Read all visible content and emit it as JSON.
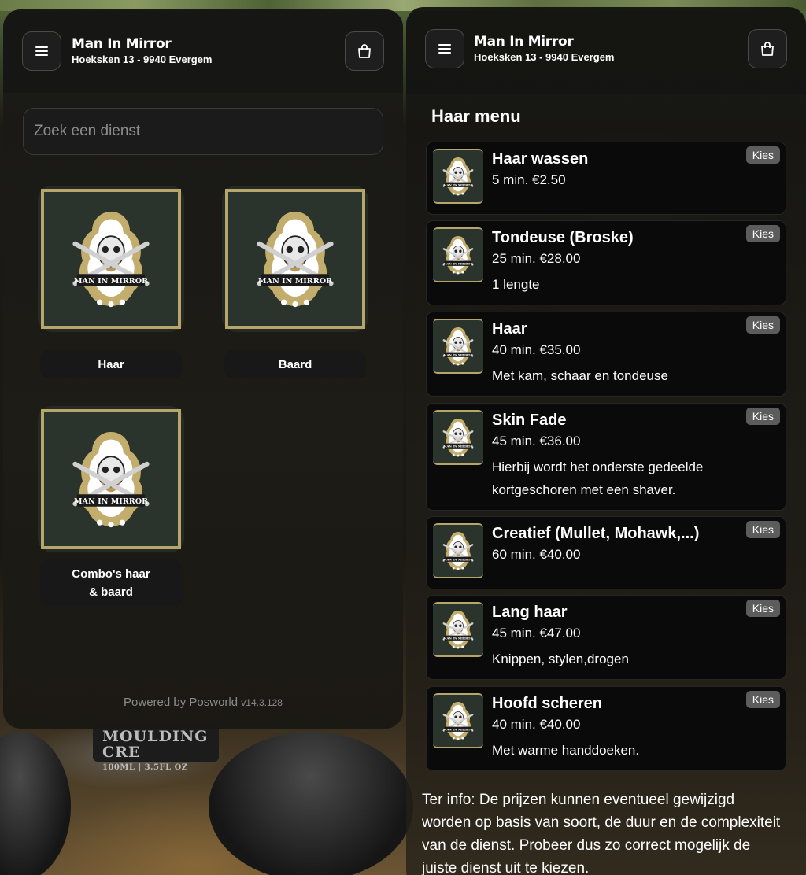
{
  "shop": {
    "name": "Man In Mirror",
    "address": "Hoeksken 13 - 9940 Evergem",
    "logo_text": "MAN IN MIRROR"
  },
  "icons": {
    "menu": "hamburger-menu-icon",
    "cart": "shopping-bag-icon"
  },
  "colors": {
    "accent_gold": "#b7a66a",
    "panel_bg": "#181816",
    "tile_bg": "#2a332c",
    "kies_badge": "#5c5c5c"
  },
  "background": {
    "jar_label": "MOULDING CRE",
    "jar_sublabel": "100ML | 3.5FL OZ"
  },
  "search": {
    "placeholder": "Zoek een dienst"
  },
  "categories": [
    {
      "label": "Haar"
    },
    {
      "label": "Baard"
    },
    {
      "label": "Combo's haar\n& baard"
    }
  ],
  "footer": {
    "powered": "Powered by Posworld",
    "version": "v14.3.128"
  },
  "menu": {
    "title": "Haar menu",
    "select_label": "Kies",
    "services": [
      {
        "name": "Haar wassen",
        "meta": "5 min. €2.50",
        "desc": ""
      },
      {
        "name": "Tondeuse (Broske)",
        "meta": "25 min. €28.00",
        "desc": "1 lengte"
      },
      {
        "name": "Haar",
        "meta": "40 min. €35.00",
        "desc": "Met kam, schaar en tondeuse"
      },
      {
        "name": "Skin Fade",
        "meta": "45 min. €36.00",
        "desc": "Hierbij wordt het onderste gedeelde kortgeschoren met een shaver."
      },
      {
        "name": "Creatief (Mullet, Mohawk,...)",
        "meta": "60 min. €40.00",
        "desc": ""
      },
      {
        "name": "Lang haar",
        "meta": "45 min. €47.00",
        "desc": "Knippen, stylen,drogen"
      },
      {
        "name": "Hoofd scheren",
        "meta": "40 min. €40.00",
        "desc": "Met warme handdoeken."
      }
    ],
    "info": "Ter info: De prijzen kunnen eventueel gewijzigd worden op basis van soort, de duur en de complexiteit van de dienst. Probeer dus zo correct mogelijk de juiste dienst uit te kiezen."
  }
}
